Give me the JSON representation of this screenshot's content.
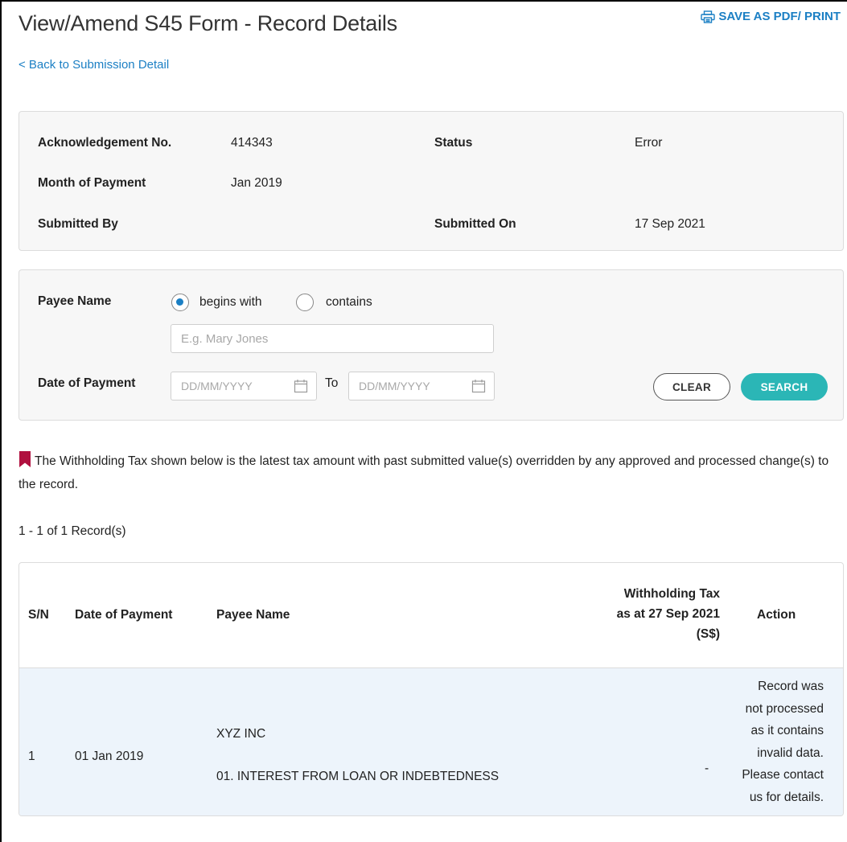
{
  "header": {
    "title": "View/Amend S45 Form - Record Details",
    "print_label": "SAVE AS PDF/ PRINT",
    "back_link": "< Back to Submission Detail"
  },
  "info": {
    "ack_label": "Acknowledgement No.",
    "ack_value": "414343",
    "status_label": "Status",
    "status_value": "Error",
    "month_label": "Month of Payment",
    "month_value": "Jan 2019",
    "submitted_by_label": "Submitted By",
    "submitted_by_value": "",
    "submitted_on_label": "Submitted On",
    "submitted_on_value": "17 Sep 2021"
  },
  "search": {
    "payee_label": "Payee Name",
    "begins_with_label": "begins with",
    "contains_label": "contains",
    "payee_placeholder": "E.g. Mary Jones",
    "date_label": "Date of Payment",
    "date_from_placeholder": "DD/MM/YYYY",
    "to_label": "To",
    "date_to_placeholder": "DD/MM/YYYY",
    "clear_label": "CLEAR",
    "search_label": "SEARCH"
  },
  "notice": {
    "text": "The Withholding Tax shown below is the latest tax amount with past submitted value(s) overridden by any approved and processed change(s) to the record."
  },
  "records": {
    "count_text": "1 - 1 of 1 Record(s)"
  },
  "table": {
    "headers": {
      "sn": "S/N",
      "date": "Date of Payment",
      "payee": "Payee Name",
      "tax_line1": "Withholding Tax",
      "tax_line2": "as at 27 Sep 2021",
      "tax_line3": "(S$)",
      "action": "Action"
    },
    "rows": [
      {
        "sn": "1",
        "date": "01 Jan 2019",
        "payee_name": "XYZ INC",
        "payee_detail": "01. INTEREST FROM LOAN OR INDEBTEDNESS",
        "tax": "-",
        "action_lines": [
          "Record was",
          "not processed",
          "as it contains",
          "invalid data.",
          "Please contact",
          "us for details."
        ]
      }
    ]
  },
  "colors": {
    "link": "#1b7fc4",
    "search_button": "#2bb6b6",
    "bookmark": "#b0103f",
    "row_highlight": "#edf4fb"
  }
}
